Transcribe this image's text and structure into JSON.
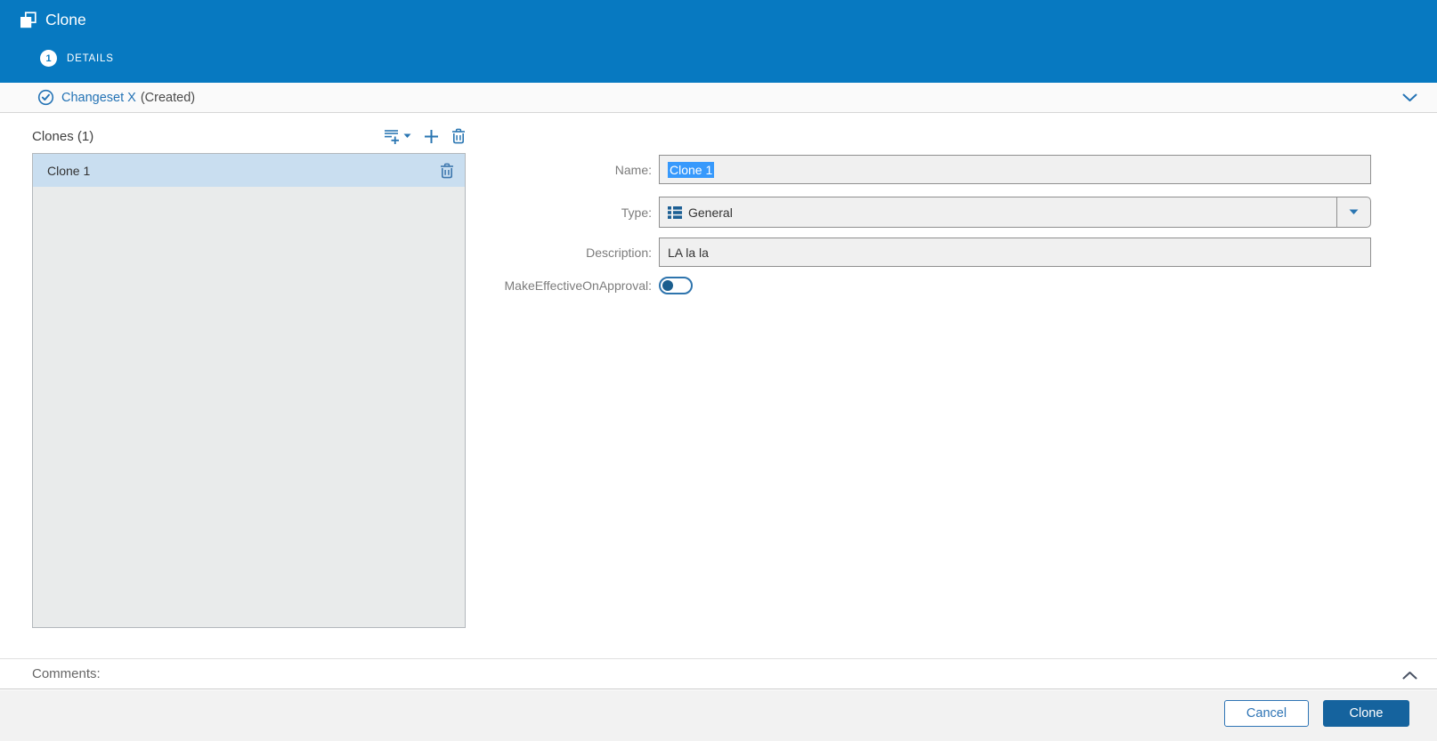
{
  "header": {
    "title": "Clone",
    "step_number": "1",
    "step_label": "DETAILS"
  },
  "changeset": {
    "link_text": "Changeset X",
    "status_text": "(Created)"
  },
  "clones_panel": {
    "title": "Clones (1)",
    "items": [
      {
        "label": "Clone 1",
        "selected": true
      }
    ]
  },
  "form": {
    "name_label": "Name:",
    "name_value": "Clone 1",
    "name_value_selected": true,
    "type_label": "Type:",
    "type_value": "General",
    "description_label": "Description:",
    "description_value": "LA la la",
    "make_effective_label": "MakeEffectiveOnApproval:",
    "make_effective_state": "off"
  },
  "comments": {
    "label": "Comments:"
  },
  "footer": {
    "cancel_label": "Cancel",
    "clone_label": "Clone"
  },
  "icons": {
    "title": "clone-icon",
    "changeset": "check-circle-icon",
    "changeset_expander": "chevron-down-icon",
    "panel_actions": [
      "add-multiple-icon",
      "caret-down-icon",
      "plus-icon",
      "trash-icon"
    ],
    "list_item": "trash-icon",
    "type_value": "type-grid-icon",
    "type_dropdown": "caret-down-icon",
    "comments_expander": "chevron-up-icon"
  },
  "colors": {
    "header_blue": "#0779c1",
    "link_blue": "#2473b5",
    "icon_blue": "#2a76b2",
    "type_icon_blue": "#1c5f94",
    "selection_blue": "#3799fc",
    "selected_row_blue": "#c9def0",
    "clone_button_blue": "#15639e",
    "cancel_border_blue": "#2e74b5",
    "list_bg": "#e9ebeb",
    "field_bg": "#f0f0f0",
    "footer_bg": "#f2f2f2"
  }
}
